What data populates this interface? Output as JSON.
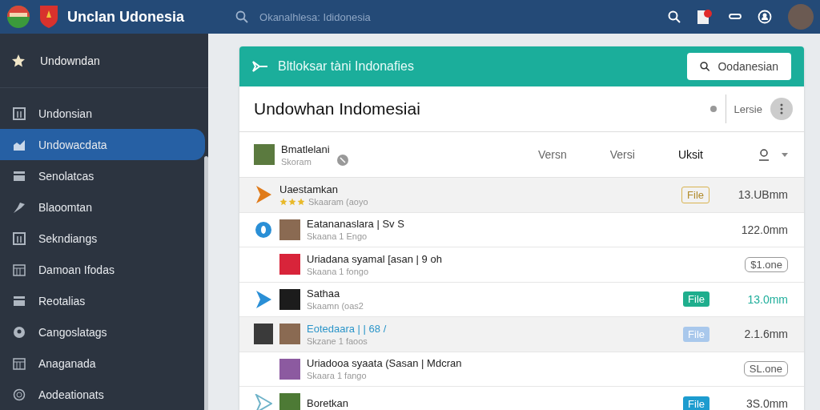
{
  "topbar": {
    "title": "Unclan Udonesia",
    "search": {
      "placeholder": "Okanalhlesa: Ididonesia"
    }
  },
  "sidebar": {
    "top_item": "Undowndan",
    "items": [
      {
        "label": "Undonsian",
        "selected": false,
        "kind": "grid"
      },
      {
        "label": "Undowacdata",
        "selected": true,
        "kind": "chart"
      },
      {
        "label": "Senolatcas",
        "selected": false,
        "kind": "card"
      },
      {
        "label": "Blaoomtan",
        "selected": false,
        "kind": "pin"
      },
      {
        "label": "Sekndiangs",
        "selected": false,
        "kind": "grid"
      },
      {
        "label": "Damoan Ifodas",
        "selected": false,
        "kind": "calendar"
      },
      {
        "label": "Reotalias",
        "selected": false,
        "kind": "card"
      },
      {
        "label": "Cangoslatags",
        "selected": false,
        "kind": "dot"
      },
      {
        "label": "Anaganada",
        "selected": false,
        "kind": "calendar"
      },
      {
        "label": "Aodeationats",
        "selected": false,
        "kind": "ring"
      }
    ]
  },
  "panel": {
    "banner": "Bltloksar tàni Indonafies",
    "banner_button": "Oodanesian",
    "title": "Undowhan Indomesiai",
    "title_action": "Lersie",
    "header": {
      "name": "Bmatlelani",
      "sub": "Skoram",
      "columns": [
        {
          "label": "Versn",
          "selected": false
        },
        {
          "label": "Versi",
          "selected": false
        },
        {
          "label": "Uksit",
          "selected": true
        }
      ]
    },
    "rows": [
      {
        "lead": {
          "kind": "play",
          "color": "#e07b1a"
        },
        "thumb": {
          "kind": "none"
        },
        "title": "Uaestamkan",
        "subtitle": "Skaaram (aoyo",
        "stars": 3,
        "badge": {
          "text": "File",
          "kind": "outline"
        },
        "size": {
          "text": "13.UBmm",
          "kind": "plain"
        },
        "highlighted": true
      },
      {
        "lead": {
          "kind": "circle",
          "color": "#2a8fd6"
        },
        "thumb": {
          "kind": "photo"
        },
        "title": "Eatananaslara | Sv S",
        "subtitle": "Skaana 1 Engo",
        "size": {
          "text": "122.0mm",
          "kind": "plain"
        },
        "highlighted": false
      },
      {
        "lead": {
          "kind": "none"
        },
        "thumb": {
          "kind": "red"
        },
        "title": "Uriadana syamal [asan | 9 oh",
        "subtitle": "Skaana 1 fongo",
        "size": {
          "text": "$1.one",
          "kind": "pill"
        },
        "highlighted": false
      },
      {
        "lead": {
          "kind": "play",
          "color": "#2a8fd6"
        },
        "thumb": {
          "kind": "dark"
        },
        "title": "Sathaa",
        "subtitle": "Skaamn (oas2",
        "badge": {
          "text": "File",
          "kind": "solid"
        },
        "size": {
          "text": "13.0mm",
          "kind": "accent"
        },
        "highlighted": false
      },
      {
        "lead": {
          "kind": "photo"
        },
        "thumb": {
          "kind": "photo"
        },
        "title": "Eotedaara | | 68 /",
        "subtitle": "Skzane 1 faoos",
        "badge": {
          "text": "File",
          "kind": "faded"
        },
        "size": {
          "text": "2.1.6mm",
          "kind": "plain"
        },
        "highlighted": true
      },
      {
        "lead": {
          "kind": "none"
        },
        "thumb": {
          "kind": "purple"
        },
        "title": "Uriadooa syaata (Sasan | Mdcran",
        "subtitle": "Skaara 1 fango",
        "size": {
          "text": "SL.one",
          "kind": "pill"
        },
        "highlighted": false
      },
      {
        "lead": {
          "kind": "outline",
          "color": "#6fb3c9"
        },
        "thumb": {
          "kind": "green"
        },
        "title": "Boretkan",
        "badge": {
          "text": "File",
          "kind": "blue"
        },
        "size": {
          "text": "3S.0mm",
          "kind": "plain"
        },
        "highlighted": false
      }
    ]
  }
}
